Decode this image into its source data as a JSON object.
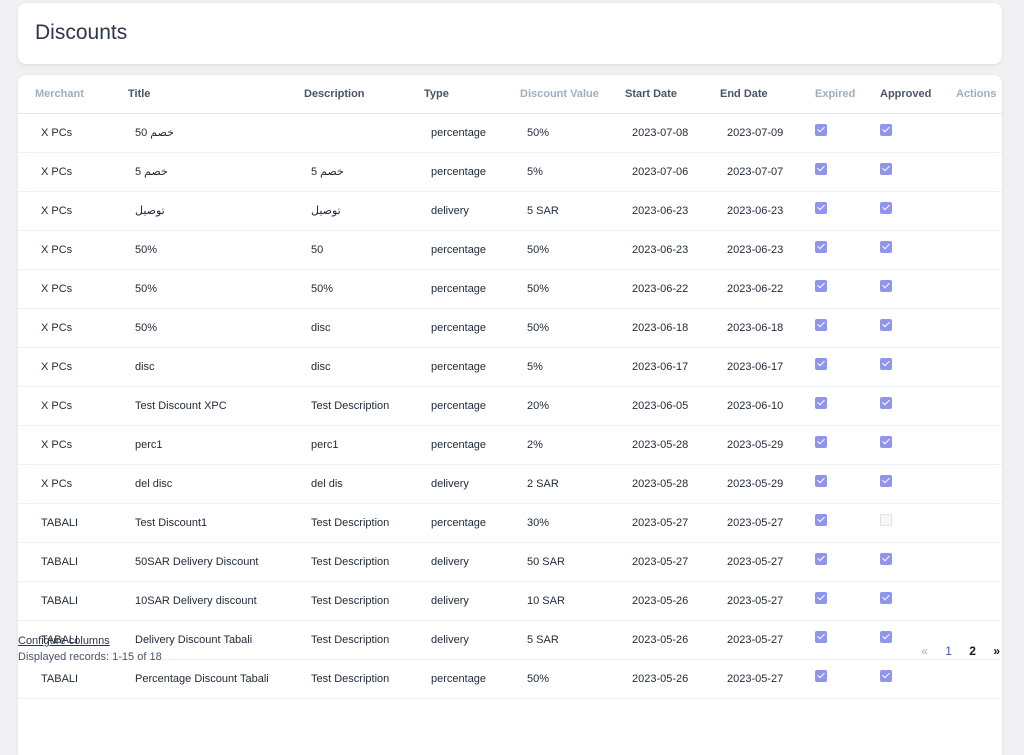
{
  "page": {
    "title": "Discounts"
  },
  "columns": [
    "Merchant",
    "Title",
    "Description",
    "Type",
    "Discount Value",
    "Start Date",
    "End Date",
    "Expired",
    "Approved",
    "Actions"
  ],
  "rows": [
    {
      "merchant": "X PCs",
      "title": "خصم 50",
      "description": "",
      "type": "percentage",
      "value": "50%",
      "start": "2023-07-08",
      "end": "2023-07-09",
      "expired": true,
      "approved": true
    },
    {
      "merchant": "X PCs",
      "title": "خصم 5",
      "description": "خصم 5",
      "type": "percentage",
      "value": "5%",
      "start": "2023-07-06",
      "end": "2023-07-07",
      "expired": true,
      "approved": true
    },
    {
      "merchant": "X PCs",
      "title": "توصيل",
      "description": "توصيل",
      "type": "delivery",
      "value": "5 SAR",
      "start": "2023-06-23",
      "end": "2023-06-23",
      "expired": true,
      "approved": true
    },
    {
      "merchant": "X PCs",
      "title": "50%",
      "description": "50",
      "type": "percentage",
      "value": "50%",
      "start": "2023-06-23",
      "end": "2023-06-23",
      "expired": true,
      "approved": true
    },
    {
      "merchant": "X PCs",
      "title": "50%",
      "description": "50%",
      "type": "percentage",
      "value": "50%",
      "start": "2023-06-22",
      "end": "2023-06-22",
      "expired": true,
      "approved": true
    },
    {
      "merchant": "X PCs",
      "title": "50%",
      "description": "disc",
      "type": "percentage",
      "value": "50%",
      "start": "2023-06-18",
      "end": "2023-06-18",
      "expired": true,
      "approved": true
    },
    {
      "merchant": "X PCs",
      "title": "disc",
      "description": "disc",
      "type": "percentage",
      "value": "5%",
      "start": "2023-06-17",
      "end": "2023-06-17",
      "expired": true,
      "approved": true
    },
    {
      "merchant": "X PCs",
      "title": "Test Discount XPC",
      "description": "Test Description",
      "type": "percentage",
      "value": "20%",
      "start": "2023-06-05",
      "end": "2023-06-10",
      "expired": true,
      "approved": true
    },
    {
      "merchant": "X PCs",
      "title": "perc1",
      "description": "perc1",
      "type": "percentage",
      "value": "2%",
      "start": "2023-05-28",
      "end": "2023-05-29",
      "expired": true,
      "approved": true
    },
    {
      "merchant": "X PCs",
      "title": "del disc",
      "description": "del dis",
      "type": "delivery",
      "value": "2 SAR",
      "start": "2023-05-28",
      "end": "2023-05-29",
      "expired": true,
      "approved": true
    },
    {
      "merchant": "TABALI",
      "title": "Test Discount1",
      "description": "Test Description",
      "type": "percentage",
      "value": "30%",
      "start": "2023-05-27",
      "end": "2023-05-27",
      "expired": true,
      "approved": false
    },
    {
      "merchant": "TABALI",
      "title": "50SAR Delivery Discount",
      "description": "Test Description",
      "type": "delivery",
      "value": "50 SAR",
      "start": "2023-05-27",
      "end": "2023-05-27",
      "expired": true,
      "approved": true
    },
    {
      "merchant": "TABALI",
      "title": "10SAR Delivery discount",
      "description": "Test Description",
      "type": "delivery",
      "value": "10 SAR",
      "start": "2023-05-26",
      "end": "2023-05-27",
      "expired": true,
      "approved": true
    },
    {
      "merchant": "TABALI",
      "title": "Delivery Discount Tabali",
      "description": "Test Description",
      "type": "delivery",
      "value": "5 SAR",
      "start": "2023-05-26",
      "end": "2023-05-27",
      "expired": true,
      "approved": true
    },
    {
      "merchant": "TABALI",
      "title": "Percentage Discount Tabali",
      "description": "Test Description",
      "type": "percentage",
      "value": "50%",
      "start": "2023-05-26",
      "end": "2023-05-27",
      "expired": true,
      "approved": true
    }
  ],
  "footer": {
    "configure_label": "Configure columns",
    "records_label": "Displayed records: 1-15 of 18"
  },
  "pagination": {
    "prev": "«",
    "pages": [
      "1",
      "2"
    ],
    "current": "2",
    "next": "»"
  },
  "colors": {
    "checkbox_checked": "#8e95eb",
    "link": "#3b5ba9"
  }
}
